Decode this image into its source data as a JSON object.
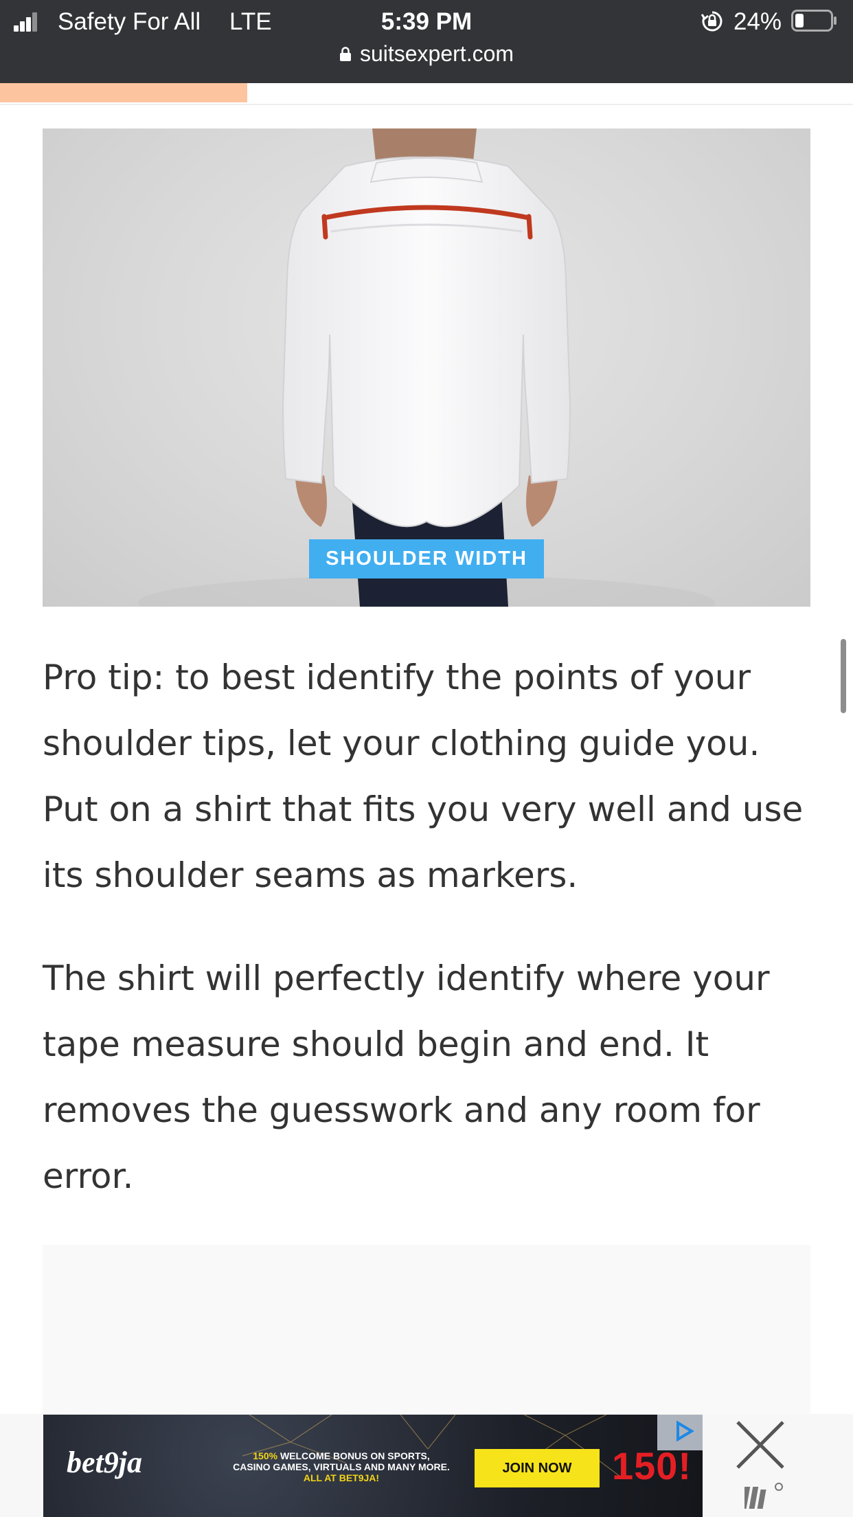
{
  "status_bar": {
    "carrier": "Safety For All",
    "network": "LTE",
    "time": "5:39 PM",
    "battery_percent": "24%",
    "battery_level": 0.24,
    "signal_bars": 3,
    "url": "suitsexpert.com"
  },
  "reading_progress": 0.29,
  "hero_image": {
    "caption": "SHOULDER WIDTH",
    "caption_color": "#41aef0",
    "measure_line_color": "#c0391f"
  },
  "article": {
    "paragraphs": [
      "Pro tip: to best identify the points of your shoulder tips, let your clothing guide you. Put on a shirt that fits you very well and use its shoulder seams as markers.",
      "The shirt will perfectly identify where your tape measure should begin and end. It removes the guesswork and any room for error."
    ]
  },
  "bottom_ad": {
    "logo": "bet9ja",
    "line_highlight": "150%",
    "line1": "WELCOME BONUS ON SPORTS,",
    "line2": "CASINO GAMES, VIRTUALS AND MANY MORE.",
    "line3": "ALL AT BET9JA!",
    "cta": "JOIN NOW",
    "big_text": "150!",
    "icons": [
      "ad-choices-icon",
      "close-icon",
      "ad-network-logo-icon"
    ]
  }
}
